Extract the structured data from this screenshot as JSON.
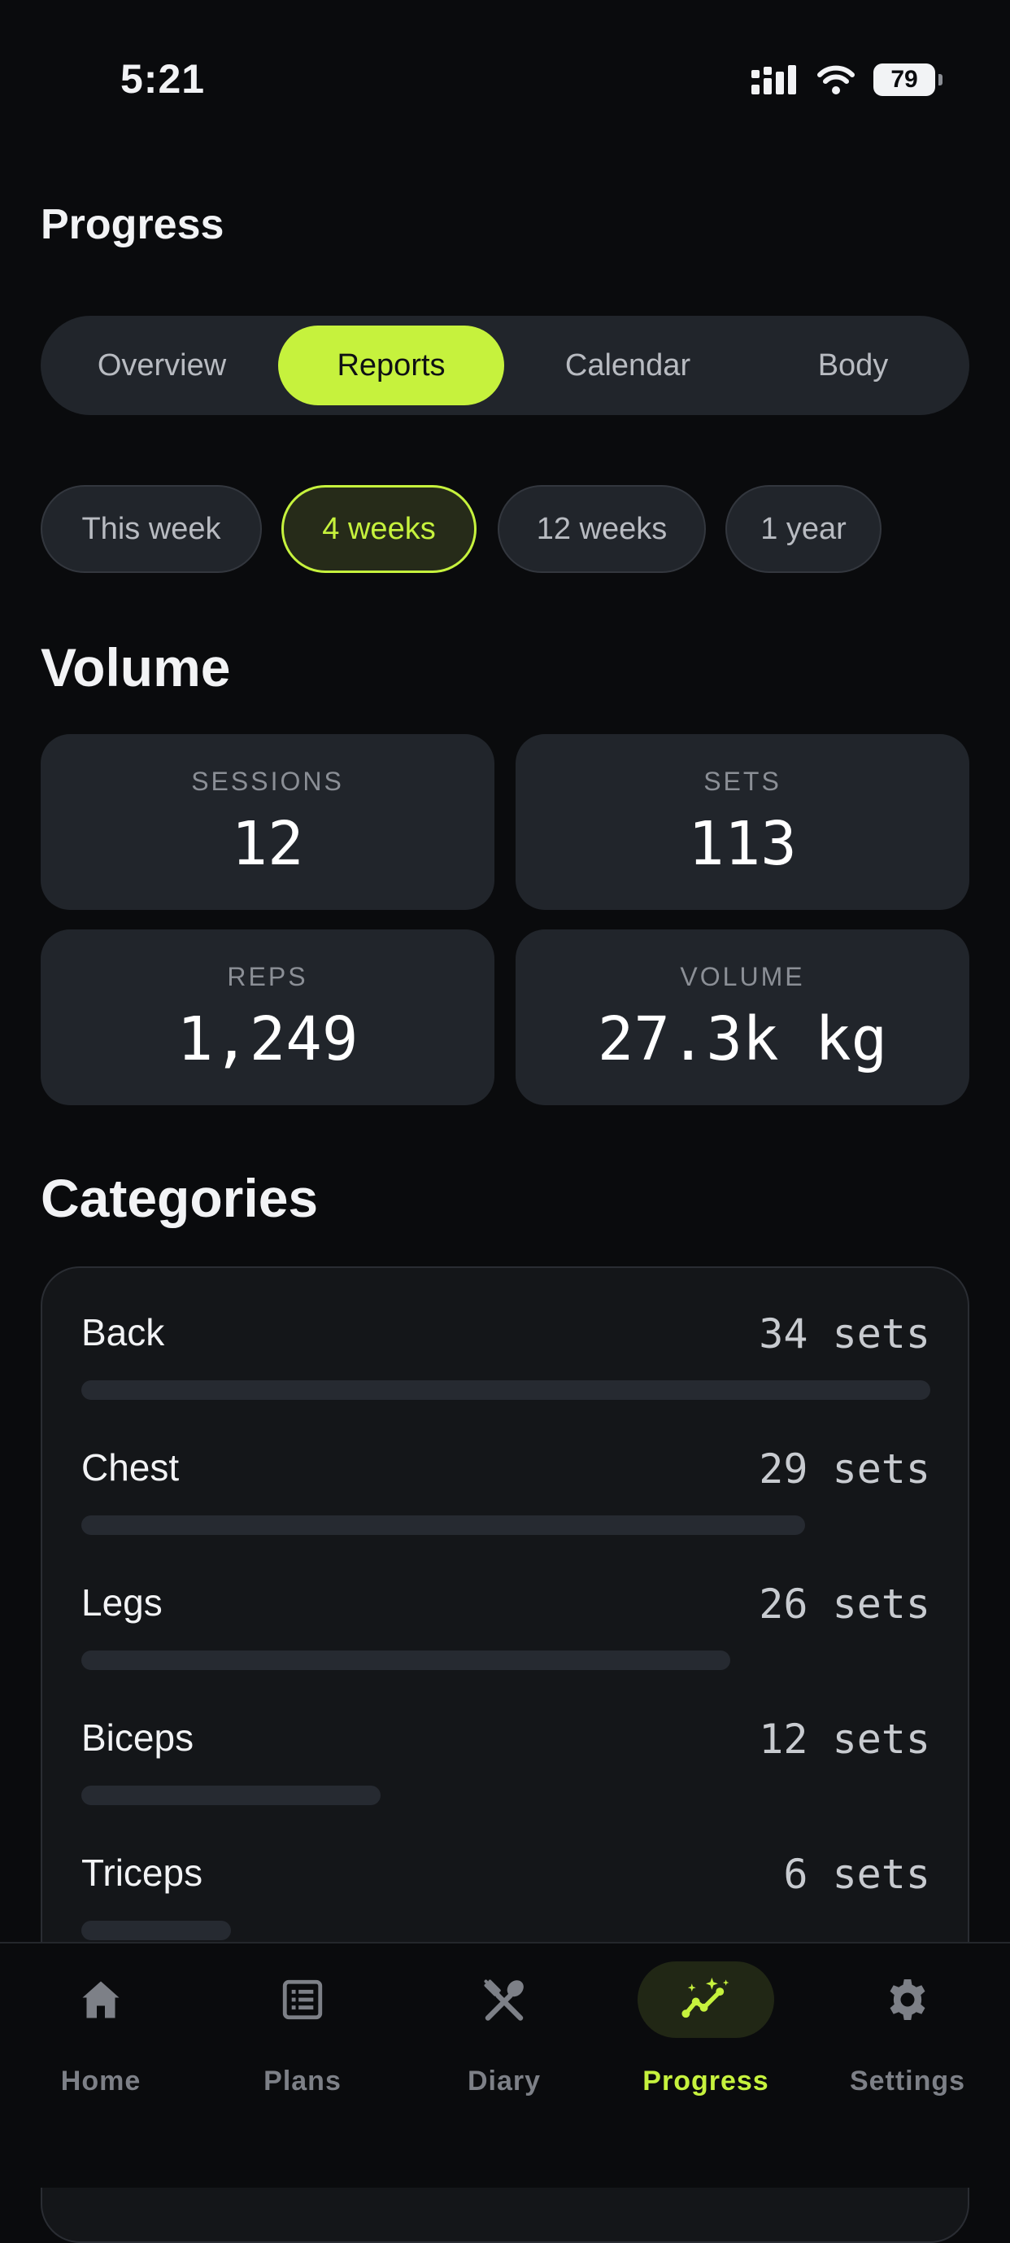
{
  "status_bar": {
    "time": "5:21",
    "battery": "79",
    "icons": [
      "cellular-signal-icon",
      "wifi-icon",
      "battery-icon"
    ]
  },
  "page_title": "Progress",
  "tabs": [
    {
      "label": "Overview",
      "active": false
    },
    {
      "label": "Reports",
      "active": true
    },
    {
      "label": "Calendar",
      "active": false
    },
    {
      "label": "Body",
      "active": false
    }
  ],
  "ranges": [
    {
      "label": "This week",
      "active": false
    },
    {
      "label": "4 weeks",
      "active": true
    },
    {
      "label": "12 weeks",
      "active": false
    },
    {
      "label": "1 year",
      "active": false
    }
  ],
  "volume": {
    "title": "Volume",
    "stats": [
      {
        "label": "SESSIONS",
        "value": "12"
      },
      {
        "label": "SETS",
        "value": "113"
      },
      {
        "label": "REPS",
        "value": "1,249"
      },
      {
        "label": "VOLUME",
        "value": "27.3k kg"
      }
    ]
  },
  "categories": {
    "title": "Categories",
    "items": [
      {
        "name": "Back",
        "count": "34 sets",
        "sets": 34
      },
      {
        "name": "Chest",
        "count": "29 sets",
        "sets": 29
      },
      {
        "name": "Legs",
        "count": "26 sets",
        "sets": 26
      },
      {
        "name": "Biceps",
        "count": "12 sets",
        "sets": 12
      },
      {
        "name": "Triceps",
        "count": "6 sets",
        "sets": 6
      }
    ]
  },
  "nav": [
    {
      "label": "Home",
      "icon": "home-icon",
      "active": false
    },
    {
      "label": "Plans",
      "icon": "list-icon",
      "active": false
    },
    {
      "label": "Diary",
      "icon": "utensils-icon",
      "active": false
    },
    {
      "label": "Progress",
      "icon": "trend-sparkle-icon",
      "active": true
    },
    {
      "label": "Settings",
      "icon": "gear-icon",
      "active": false
    }
  ],
  "colors": {
    "accent": "#c6f23d",
    "background": "#0a0b0d",
    "card": "#21252b"
  }
}
